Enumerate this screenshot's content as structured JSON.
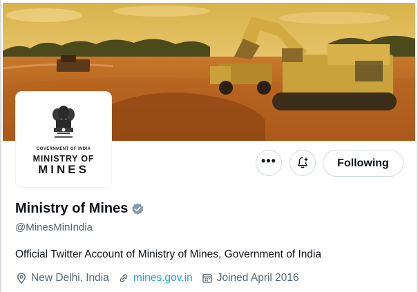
{
  "profile": {
    "display_name": "Ministry of Mines",
    "handle": "@MinesMinIndia",
    "bio": "Official Twitter Account of Ministry of Mines, Government of India",
    "location": "New Delhi, India",
    "website": "mines.gov.in",
    "joined": "Joined April 2016",
    "verified_badge_color": "#829aab"
  },
  "avatar": {
    "line1": "GOVERNMENT OF INDIA",
    "line2": "MINISTRY OF",
    "line3": "MINES"
  },
  "actions": {
    "more_label": "•••",
    "follow_label": "Following"
  },
  "icons": {
    "more": "more-dots-icon",
    "notify": "bell-plus-icon",
    "location": "location-pin-icon",
    "link": "link-icon",
    "calendar": "calendar-icon",
    "verified": "verified-badge-icon"
  },
  "colors": {
    "link": "#1d9bf0",
    "secondary_text": "#536471",
    "primary_text": "#0f1419",
    "border": "#cfd9de"
  }
}
